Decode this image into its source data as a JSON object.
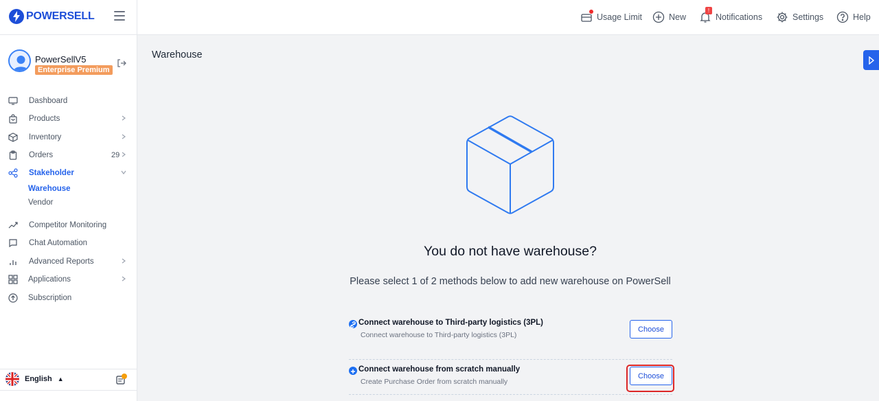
{
  "brand": {
    "name": "POWERSELL",
    "accent": "#2563eb"
  },
  "user": {
    "name": "PowerSellV5",
    "plan": "Enterprise Premium"
  },
  "nav": {
    "items": [
      {
        "label": "Dashboard",
        "icon": "monitor-icon"
      },
      {
        "label": "Products",
        "icon": "bag-icon"
      },
      {
        "label": "Inventory",
        "icon": "cube-icon"
      },
      {
        "label": "Orders",
        "icon": "clipboard-icon",
        "count": "29"
      },
      {
        "label": "Stakeholder",
        "icon": "share-icon"
      },
      {
        "label": "Competitor Monitoring",
        "icon": "trend-icon"
      },
      {
        "label": "Chat Automation",
        "icon": "chat-icon"
      },
      {
        "label": "Advanced Reports",
        "icon": "bar-chart-icon"
      },
      {
        "label": "Applications",
        "icon": "grid-icon"
      },
      {
        "label": "Subscription",
        "icon": "arrow-up-circle-icon"
      }
    ],
    "stakeholder_sub": [
      "Warehouse",
      "Vendor"
    ]
  },
  "footer": {
    "language": "English"
  },
  "topbar": {
    "usage_limit": "Usage Limit",
    "new": "New",
    "notifications": "Notifications",
    "notifications_badge": "!",
    "settings": "Settings",
    "help": "Help"
  },
  "page": {
    "title": "Warehouse",
    "empty_title": "You do not have warehouse?",
    "empty_subtitle": "Please select 1 of 2 methods below to add new warehouse on PowerSell"
  },
  "options": [
    {
      "title": "Connect warehouse to Third-party logistics (3PL)",
      "desc": "Connect warehouse to Third-party logistics (3PL)",
      "button": "Choose"
    },
    {
      "title": "Connect warehouse from scratch manually",
      "desc": "Create Purchase Order from scratch manually",
      "button": "Choose"
    }
  ]
}
